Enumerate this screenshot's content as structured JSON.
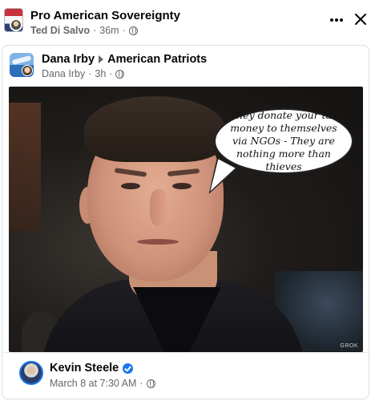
{
  "group": {
    "name": "Pro American Sovereignty",
    "author": "Ted Di Salvo",
    "separator": "·",
    "time": "36m",
    "privacy_icon": "globe-icon",
    "more_icon": "more-icon",
    "close_icon": "close-icon"
  },
  "shared_post": {
    "author": "Dana Irby",
    "target_group": "American Patriots",
    "meta_author": "Dana Irby",
    "separator": "·",
    "time": "3h",
    "privacy_icon": "globe-icon"
  },
  "meme": {
    "speech_bubble": "They donate your tax money to themselves via NGOs - They are nothing more than thieves",
    "watermark": "GROK"
  },
  "attribution": {
    "name": "Kevin Steele",
    "verified": true,
    "date": "March 8 at 7:30 AM",
    "separator": "·",
    "privacy_icon": "globe-icon"
  },
  "colors": {
    "secondary_text": "#65676b",
    "verified_blue": "#1877f2",
    "border": "#dadde1"
  }
}
